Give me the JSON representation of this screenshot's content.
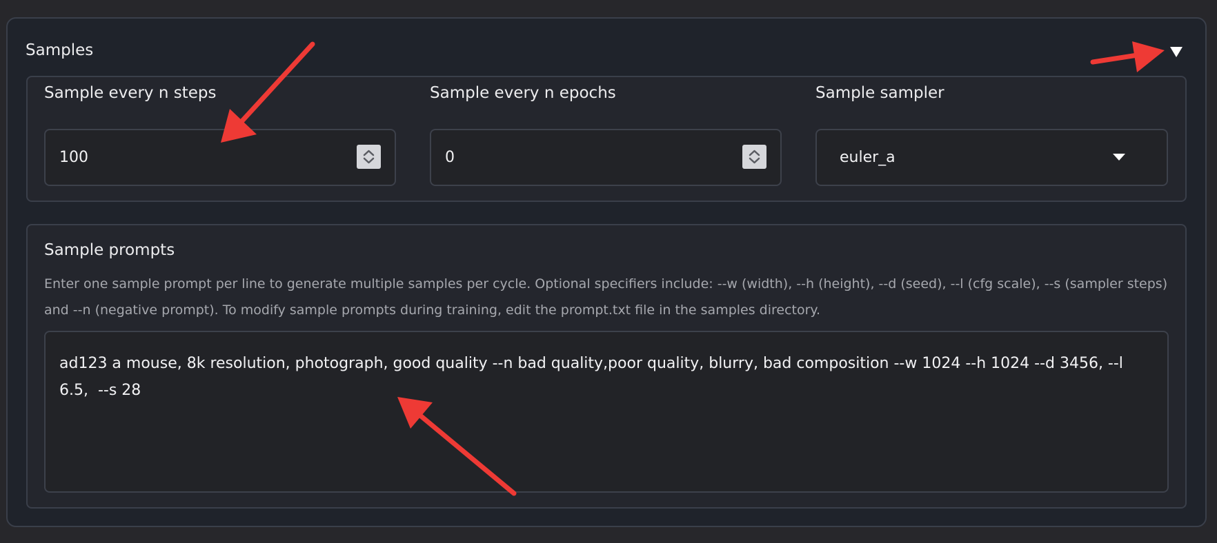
{
  "accordion": {
    "title": "Samples",
    "toggle_icon": "triangle-down-icon"
  },
  "fields": {
    "steps": {
      "label": "Sample every n steps",
      "value": "100"
    },
    "epochs": {
      "label": "Sample every n epochs",
      "value": "0"
    },
    "sampler": {
      "label": "Sample sampler",
      "value": "euler_a",
      "icon": "caret-down-icon"
    }
  },
  "prompts": {
    "label": "Sample prompts",
    "help": "Enter one sample prompt per line to generate multiple samples per cycle. Optional specifiers include: --w (width), --h (height), --d (seed), --l (cfg scale), --s (sampler steps) and --n (negative prompt). To modify sample prompts during training, edit the prompt.txt file in the samples directory.",
    "value": "ad123 a mouse, 8k resolution, photograph, good quality --n bad quality,poor quality, blurry, bad composition --w 1024 --h 1024 --d 3456, --l 6.5,  --s 28"
  },
  "colors": {
    "annotation_arrow": "#ee3a35",
    "page_background": "#27272b",
    "panel_background": "#1f232b"
  }
}
